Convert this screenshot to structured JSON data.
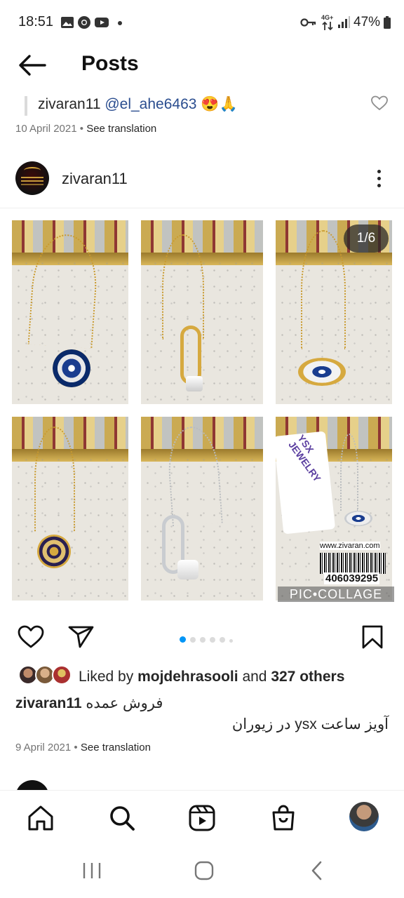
{
  "status_bar": {
    "time": "18:51",
    "network": "4G+",
    "battery": "47%",
    "left_icons": [
      "gallery-icon",
      "chrome-icon",
      "youtube-icon",
      "dot-icon"
    ],
    "right_icons": [
      "key-icon",
      "data-arrows-icon",
      "signal-icon",
      "battery-icon"
    ]
  },
  "header": {
    "title": "Posts"
  },
  "comment": {
    "author": "zivaran11",
    "mention": "@el_ahe6463",
    "emoji": "😍🙏",
    "date": "10 April 2021",
    "separator": "•",
    "see_translation": "See translation"
  },
  "post": {
    "username": "zivaran11",
    "counter": "1/6",
    "collage_watermark": "PIC•COLLAGE",
    "tag_brand": "YSX JEWELRY",
    "tag_website": "www.zivaran.com",
    "tag_barcode_number": "406039295",
    "carousel_dots": 6,
    "active_dot": 0,
    "likes": {
      "prefix": "Liked by",
      "user": "mojdehrasooli",
      "middle": "and",
      "others": "327 others"
    },
    "caption": {
      "author": "zivaran11",
      "line1": "فروش عمده",
      "line2": "آویز ساعت ysx در زیوران"
    },
    "date": "9 April 2021",
    "separator": "•",
    "see_translation": "See translation"
  },
  "colors": {
    "accent_blue": "#0095f6",
    "mention": "#2a4d8f",
    "muted": "#737373",
    "text": "#262626"
  }
}
